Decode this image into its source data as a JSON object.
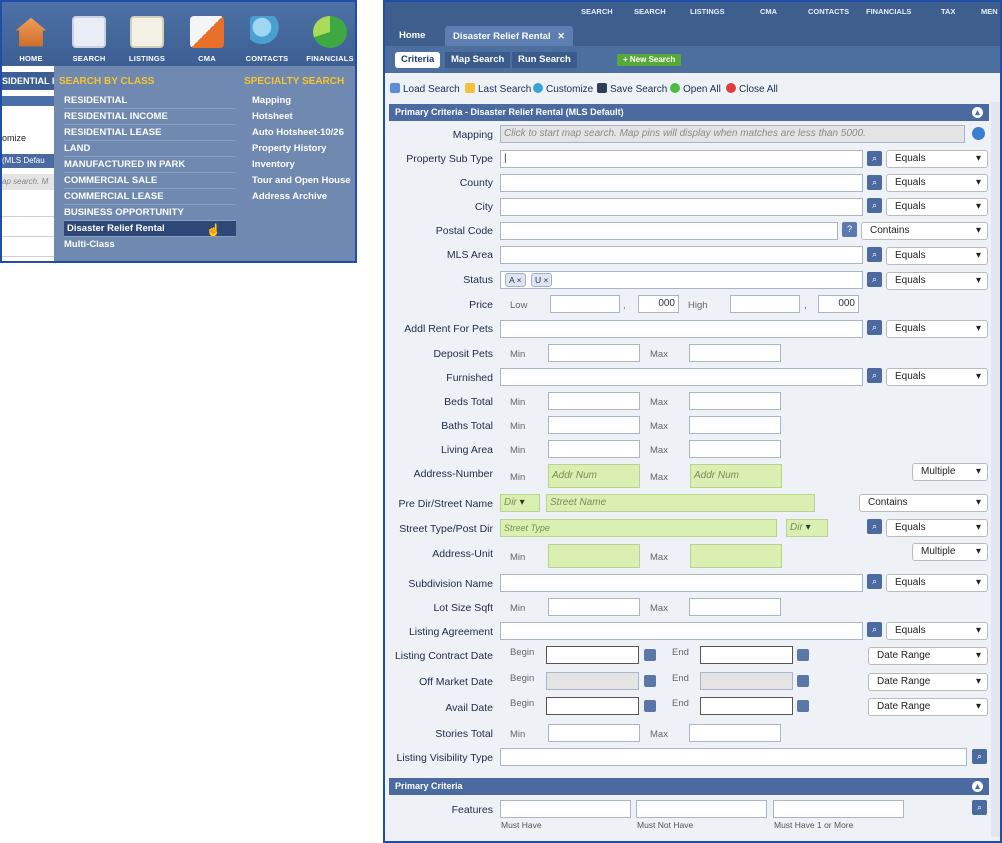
{
  "left_menu": {
    "nav": [
      {
        "label": "HOME",
        "icon": "home-icon"
      },
      {
        "label": "SEARCH",
        "icon": "search-icon"
      },
      {
        "label": "LISTINGS",
        "icon": "listings-icon"
      },
      {
        "label": "CMA",
        "icon": "cma-icon"
      },
      {
        "label": "CONTACTS",
        "icon": "contacts-icon"
      },
      {
        "label": "FINANCIALS",
        "icon": "financials-icon"
      }
    ],
    "side_snippets": [
      "SIDENTIAL I",
      "omize",
      "(MLS Defau",
      "ap search. M"
    ],
    "class_header": "SEARCH BY CLASS",
    "class_items": [
      "RESIDENTIAL",
      "RESIDENTIAL INCOME",
      "RESIDENTIAL LEASE",
      "LAND",
      "MANUFACTURED IN PARK",
      "COMMERCIAL SALE",
      "COMMERCIAL LEASE",
      "BUSINESS OPPORTUNITY",
      "Disaster Relief Rental",
      "Multi-Class"
    ],
    "specialty_header": "SPECIALTY SEARCH",
    "specialty_items": [
      "Mapping",
      "Hotsheet",
      "Auto Hotsheet-10/26",
      "Property History",
      "Inventory",
      "Tour and Open House",
      "Address Archive"
    ]
  },
  "right": {
    "top_links": [
      "SEARCH",
      "LISTINGS",
      "CMA",
      "CONTACTS",
      "FINANCIALS",
      "TAX",
      "MEN"
    ],
    "tabs": {
      "home": "Home",
      "active": "Disaster Relief Rental",
      "close": "✕"
    },
    "subtabs": {
      "criteria": "Criteria",
      "map": "Map Search",
      "run": "Run Search",
      "new": "+ New Search"
    },
    "toolbar": {
      "load": "Load Search",
      "last": "Last Search",
      "customize": "Customize",
      "save": "Save Search",
      "open": "Open All",
      "close": "Close All"
    },
    "section1": "Primary Criteria - Disaster Relief Rental (MLS Default)",
    "section2": "Primary Criteria",
    "fields": {
      "mapping": {
        "label": "Mapping",
        "placeholder": "Click to start map search. Map pins will display when matches are less than 5000."
      },
      "sub_type": {
        "label": "Property Sub Type",
        "op": "Equals"
      },
      "county": {
        "label": "County",
        "op": "Equals"
      },
      "city": {
        "label": "City",
        "op": "Equals"
      },
      "postal": {
        "label": "Postal Code",
        "op": "Contains",
        "help": "?"
      },
      "mls_area": {
        "label": "MLS Area",
        "op": "Equals"
      },
      "status": {
        "label": "Status",
        "op": "Equals",
        "chips": [
          "A",
          "U"
        ]
      },
      "price": {
        "label": "Price",
        "low": "Low",
        "high": "High",
        "low_suffix": "000",
        "high_suffix": "000",
        "comma": ","
      },
      "pets_rent": {
        "label": "Addl Rent For Pets",
        "op": "Equals"
      },
      "deposit_pets": {
        "label": "Deposit Pets",
        "min": "Min",
        "max": "Max"
      },
      "furnished": {
        "label": "Furnished",
        "op": "Equals"
      },
      "beds": {
        "label": "Beds Total",
        "min": "Min",
        "max": "Max"
      },
      "baths": {
        "label": "Baths Total",
        "min": "Min",
        "max": "Max"
      },
      "living": {
        "label": "Living Area",
        "min": "Min",
        "max": "Max"
      },
      "addr_num": {
        "label": "Address-Number",
        "min": "Min",
        "max": "Max",
        "ph": "Addr Num",
        "op": "Multiple"
      },
      "pre_dir": {
        "label": "Pre Dir/Street Name",
        "dir": "Dir",
        "street": "Street Name",
        "op": "Contains"
      },
      "street_type": {
        "label": "Street Type/Post Dir",
        "type": "Street Type",
        "dir": "Dir",
        "op": "Equals"
      },
      "addr_unit": {
        "label": "Address-Unit",
        "min": "Min",
        "max": "Max",
        "op": "Multiple"
      },
      "subdivision": {
        "label": "Subdivision Name",
        "op": "Equals"
      },
      "lot_size": {
        "label": "Lot Size Sqft",
        "min": "Min",
        "max": "Max"
      },
      "agreement": {
        "label": "Listing Agreement",
        "op": "Equals"
      },
      "contract_date": {
        "label": "Listing Contract Date",
        "begin": "Begin",
        "end": "End",
        "op": "Date Range"
      },
      "off_market": {
        "label": "Off Market Date",
        "begin": "Begin",
        "end": "End",
        "op": "Date Range"
      },
      "avail": {
        "label": "Avail Date",
        "begin": "Begin",
        "end": "End",
        "op": "Date Range"
      },
      "stories": {
        "label": "Stories Total",
        "min": "Min",
        "max": "Max"
      },
      "visibility": {
        "label": "Listing Visibility Type"
      },
      "features": {
        "label": "Features",
        "must": "Must Have",
        "must_not": "Must Not Have",
        "one_more": "Must Have 1 or More"
      }
    }
  }
}
